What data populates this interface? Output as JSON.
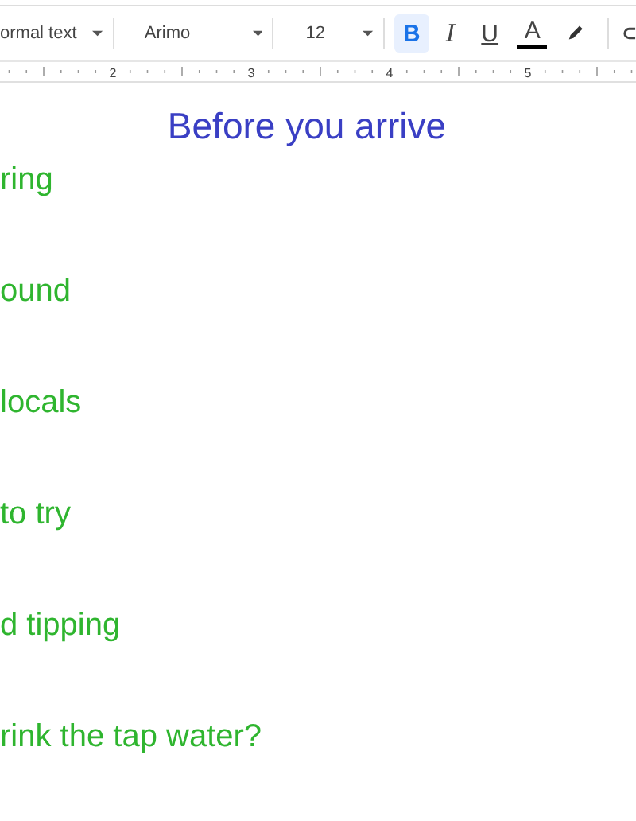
{
  "toolbar": {
    "style": "ormal text",
    "font": "Arimo",
    "size": "12",
    "format_buttons": [
      {
        "kind": "bold",
        "label": "B",
        "selected": true
      },
      {
        "kind": "italic",
        "label": "I",
        "selected": false
      },
      {
        "kind": "underline",
        "label": "U",
        "selected": false
      },
      {
        "kind": "color",
        "label": "A",
        "selected": false
      }
    ]
  },
  "ruler": {
    "numbers": [
      "2",
      "3",
      "4",
      "5"
    ]
  },
  "document": {
    "heading": "Before you arrive",
    "items": [
      "ring",
      "ound",
      "locals",
      " to try",
      "d tipping",
      "rink the tap water?"
    ]
  }
}
